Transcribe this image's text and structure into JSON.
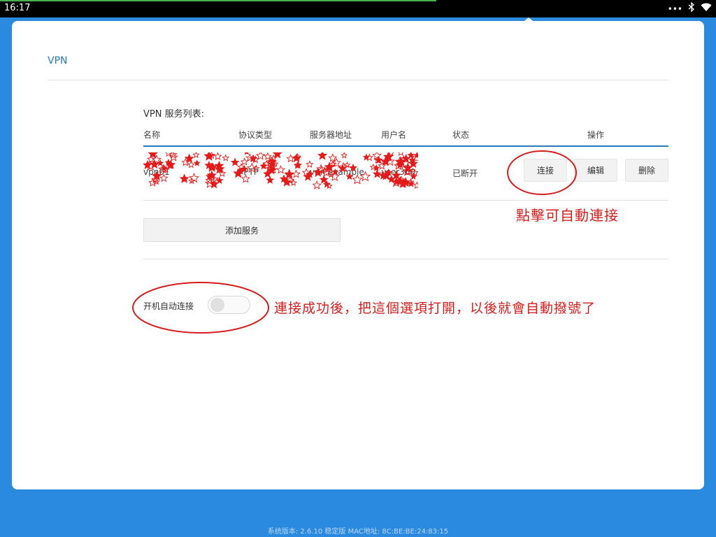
{
  "status_bar": {
    "time": "16:17",
    "icons": [
      "more-icon",
      "bluetooth-icon",
      "wifi-icon"
    ]
  },
  "page": {
    "title": "VPN"
  },
  "vpn_list": {
    "title": "VPN 服务列表:",
    "columns": [
      "名称",
      "协议类型",
      "服务器地址",
      "用户名",
      "状态",
      "操作"
    ],
    "rows": [
      {
        "name": "vpn01",
        "protocol": "PPTP",
        "server": "vpn.example",
        "username": "user360",
        "status": "已断开",
        "actions": [
          "连接",
          "编辑",
          "删除"
        ]
      }
    ]
  },
  "add_service_label": "添加服务",
  "auto_connect": {
    "label": "开机自动连接",
    "enabled": false
  },
  "annotations": {
    "click_connect": "點擊可自動連接",
    "enable_tip": "連接成功後，把這個選項打開，以後就會自動撥號了"
  },
  "footer": "系统版本: 2.6.10 稳定版 MAC地址: 8C:BE:BE:24:83:15",
  "colors": {
    "background": "#2a8ae0",
    "accent": "#2a7ab8",
    "annotation": "#d61d1d"
  }
}
